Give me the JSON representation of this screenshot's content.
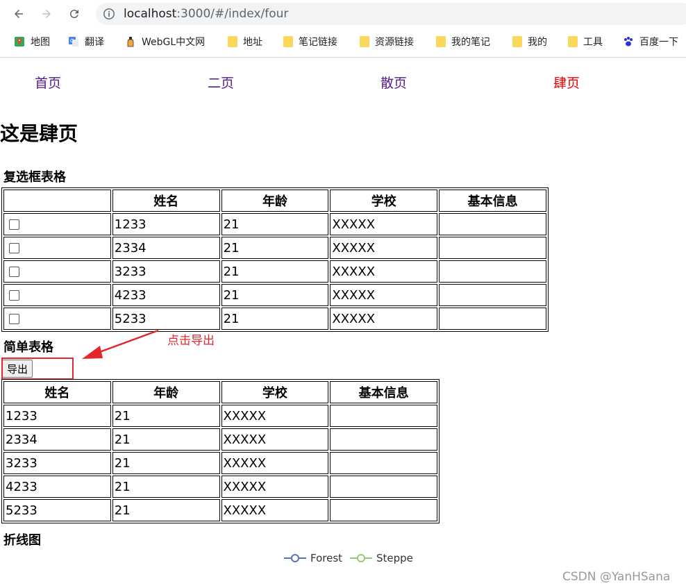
{
  "browser": {
    "url_host": "localhost",
    "url_path": ":3000/#/index/four",
    "bookmarks": [
      "地图",
      "翻译",
      "WebGL中文网",
      "地址",
      "笔记链接",
      "资源链接",
      "我的笔记",
      "我的",
      "工具",
      "百度一下"
    ]
  },
  "nav": {
    "items": [
      {
        "label": "首页",
        "active": false
      },
      {
        "label": "二页",
        "active": false
      },
      {
        "label": "散页",
        "active": false
      },
      {
        "label": "肆页",
        "active": true
      }
    ]
  },
  "page_title": "这是肆页",
  "checkbox_table": {
    "title": "复选框表格",
    "headers": [
      "",
      "姓名",
      "年龄",
      "学校",
      "基本信息"
    ],
    "rows": [
      {
        "name": "1233",
        "age": "21",
        "school": "XXXXX",
        "info": ""
      },
      {
        "name": "2334",
        "age": "21",
        "school": "XXXXX",
        "info": ""
      },
      {
        "name": "3233",
        "age": "21",
        "school": "XXXXX",
        "info": ""
      },
      {
        "name": "4233",
        "age": "21",
        "school": "XXXXX",
        "info": ""
      },
      {
        "name": "5233",
        "age": "21",
        "school": "XXXXX",
        "info": ""
      }
    ]
  },
  "simple_table": {
    "title": "简单表格",
    "export_label": "导出",
    "headers": [
      "姓名",
      "年龄",
      "学校",
      "基本信息"
    ],
    "rows": [
      {
        "name": "1233",
        "age": "21",
        "school": "XXXXX",
        "info": ""
      },
      {
        "name": "2334",
        "age": "21",
        "school": "XXXXX",
        "info": ""
      },
      {
        "name": "3233",
        "age": "21",
        "school": "XXXXX",
        "info": ""
      },
      {
        "name": "4233",
        "age": "21",
        "school": "XXXXX",
        "info": ""
      },
      {
        "name": "5233",
        "age": "21",
        "school": "XXXXX",
        "info": ""
      }
    ]
  },
  "annotation": "点击导出",
  "line_chart": {
    "title": "折线图",
    "legend": [
      {
        "label": "Forest",
        "color": "#5470c6"
      },
      {
        "label": "Steppe",
        "color": "#91cc75"
      }
    ]
  },
  "watermark": "CSDN @YanHSana",
  "colors": {
    "link": "#551a8b",
    "active_link": "#ee0000",
    "annotation": "#e3262b"
  }
}
